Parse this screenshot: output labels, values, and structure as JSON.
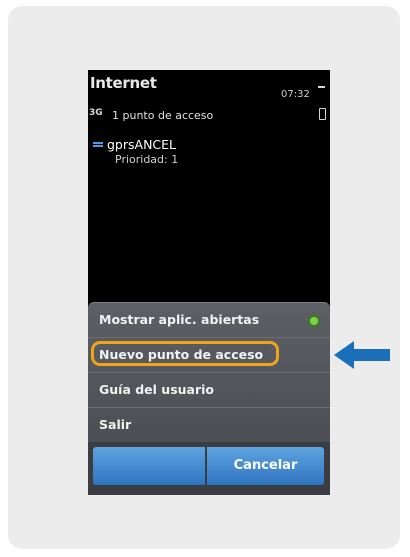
{
  "status_bar": {
    "title": "Internet",
    "time": "07:32",
    "network": "3G"
  },
  "header": {
    "count_text": "1 punto de acceso"
  },
  "access_point": {
    "name": "gprsANCEL",
    "priority": "Prioridad: 1"
  },
  "menu": {
    "items": [
      {
        "label": "Mostrar aplic. abiertas",
        "indicator": "green-dot"
      },
      {
        "label": "Nuevo punto de acceso",
        "highlighted": true
      },
      {
        "label": "Guía del usuario"
      },
      {
        "label": "Salir"
      }
    ]
  },
  "softkeys": {
    "left": "",
    "right": "Cancelar"
  },
  "colors": {
    "highlight": "#f2a418",
    "arrow": "#1b6fb8",
    "button": "#3d84cc"
  }
}
